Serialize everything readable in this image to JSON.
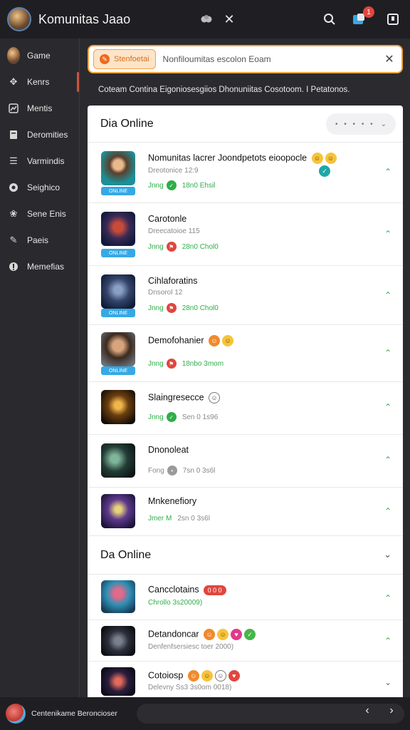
{
  "header": {
    "title": "Komunitas Jaao",
    "notification_count": "1"
  },
  "sidebar": {
    "items": [
      {
        "label": "Game",
        "icon": "avatar"
      },
      {
        "label": "Kenrs",
        "icon": "controller-icon"
      },
      {
        "label": "Mentis",
        "icon": "chart-icon"
      },
      {
        "label": "Deromities",
        "icon": "document-icon"
      },
      {
        "label": "Varmindis",
        "icon": "list-icon"
      },
      {
        "label": "Seighico",
        "icon": "globe-icon"
      },
      {
        "label": "Sene Enis",
        "icon": "people-icon"
      },
      {
        "label": "Paeis",
        "icon": "pin-icon"
      },
      {
        "label": "Memefias",
        "icon": "info-icon"
      }
    ]
  },
  "search": {
    "chip_label": "Stenfoetai",
    "value": "Nonfiloumitas escolon Eoam"
  },
  "description": "Coteam Contina Eigoniosesgiios Dhonuniitas Cosotoom. I Petatonos.",
  "section1": {
    "title": "Dia Online",
    "filter_label": "• • • • •"
  },
  "rows1": [
    {
      "name": "Nomunitas lacrer Joondpetots eioopocle",
      "sub": "Dreotonice 12:9",
      "status": "Jnng",
      "time": "18n0 Ehsil",
      "tag": "ONLINE"
    },
    {
      "name": "Carotonle",
      "sub": "Dreecatoioe 115",
      "status": "Jnng",
      "time": "28n0 Chol0",
      "tag": "ONLINE"
    },
    {
      "name": "Cihlaforatins",
      "sub": "Dnsorol 12",
      "status": "Jnng",
      "time": "28n0 Chol0",
      "tag": "ONLINE"
    },
    {
      "name": "Demofohanier",
      "sub": "",
      "status": "Jnng",
      "time": "18nbo 3mom",
      "tag": "ONLINE"
    },
    {
      "name": "Slaingresecce",
      "sub": "",
      "status": "Jnng",
      "time": "Sen 0 1s96",
      "tag": ""
    },
    {
      "name": "Dnonoleat",
      "sub": "",
      "status": "Fong",
      "time": "7sn 0 3s6l",
      "tag": ""
    },
    {
      "name": "Mnkenefiory",
      "sub": "",
      "status": "Jmer M",
      "time": "2sn 0 3s6l",
      "tag": ""
    }
  ],
  "section2": {
    "title": "Da Online"
  },
  "rows2": [
    {
      "name": "Cancclotains",
      "sub": "Chrollo 3s20009)",
      "pill": "0 0 0"
    },
    {
      "name": "Detandoncar",
      "sub": "Denfenfsersiesc toer 2000)"
    },
    {
      "name": "Cotoiosp",
      "sub": "Delevny Ss3 3s0om 0018)"
    }
  ],
  "bottom": {
    "label": "Centenikame Beroncioser"
  },
  "colors": {
    "accent": "#f3a23d",
    "online": "#2fae49",
    "alert": "#e0463f"
  }
}
